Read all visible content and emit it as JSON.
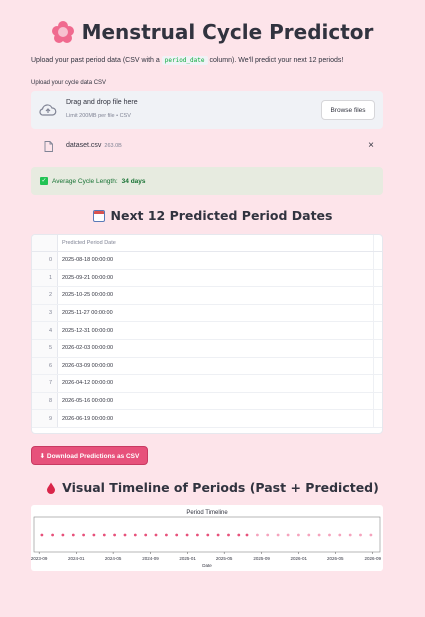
{
  "header": {
    "title": "Menstrual Cycle Predictor",
    "intro_before": "Upload your past period data (CSV with a",
    "intro_code": "period_date",
    "intro_after": "column). We'll predict your next 12 periods!"
  },
  "uploader": {
    "label": "Upload your cycle data CSV",
    "drop_title": "Drag and drop file here",
    "drop_sub": "Limit 200MB per file • CSV",
    "browse_label": "Browse files",
    "file_name": "dataset.csv",
    "file_size": "263.0B",
    "close_symbol": "×"
  },
  "success": {
    "label": "Average Cycle Length:",
    "value": "34 days"
  },
  "predictions": {
    "heading": "Next 12 Predicted Period Dates",
    "column": "Predicted Period Date",
    "rows": [
      {
        "idx": "0",
        "date": "2025-08-18 00:00:00"
      },
      {
        "idx": "1",
        "date": "2025-09-21 00:00:00"
      },
      {
        "idx": "2",
        "date": "2025-10-25 00:00:00"
      },
      {
        "idx": "3",
        "date": "2025-11-27 00:00:00"
      },
      {
        "idx": "4",
        "date": "2025-12-31 00:00:00"
      },
      {
        "idx": "5",
        "date": "2026-02-03 00:00:00"
      },
      {
        "idx": "6",
        "date": "2026-03-09 00:00:00"
      },
      {
        "idx": "7",
        "date": "2026-04-12 00:00:00"
      },
      {
        "idx": "8",
        "date": "2026-05-16 00:00:00"
      },
      {
        "idx": "9",
        "date": "2026-06-19 00:00:00"
      }
    ],
    "download_label": "⬇ Download Predictions as CSV"
  },
  "timeline": {
    "heading": "Visual Timeline of Periods (Past + Predicted)"
  },
  "chart_data": {
    "type": "scatter",
    "title": "Period Timeline",
    "xlabel": "Date",
    "ylabel": "",
    "x_ticks": [
      "2023-09",
      "2024-01",
      "2024-05",
      "2024-09",
      "2025-01",
      "2025-05",
      "2025-09",
      "2026-01",
      "2026-05",
      "2026-09"
    ],
    "xlim": [
      "2023-08-15",
      "2026-09-25"
    ],
    "grid": false,
    "series": [
      {
        "color": "#e7517b",
        "dates": [
          "2023-09-10",
          "2023-10-15",
          "2023-11-18",
          "2023-12-22",
          "2024-01-25",
          "2024-02-28",
          "2024-04-02",
          "2024-05-06",
          "2024-06-09",
          "2024-07-13",
          "2024-08-16",
          "2024-09-19",
          "2024-10-23",
          "2024-11-26",
          "2024-12-30",
          "2025-02-02",
          "2025-03-08",
          "2025-04-11",
          "2025-05-15",
          "2025-06-18",
          "2025-07-15"
        ]
      },
      {
        "color": "#f5a3bd",
        "dates": [
          "2025-08-18",
          "2025-09-21",
          "2025-10-25",
          "2025-11-27",
          "2025-12-31",
          "2026-02-03",
          "2026-03-09",
          "2026-04-12",
          "2026-05-16",
          "2026-06-19",
          "2026-07-23",
          "2026-08-26"
        ]
      }
    ]
  }
}
